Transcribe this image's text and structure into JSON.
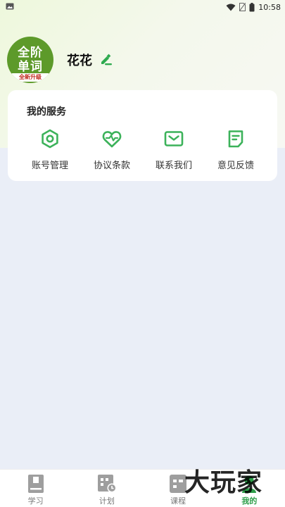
{
  "status_bar": {
    "time": "10:58"
  },
  "profile": {
    "logo_line1": "全阶",
    "logo_line2": "单词",
    "logo_tag": "全新升级",
    "username": "花花"
  },
  "services": {
    "title": "我的服务",
    "items": [
      {
        "label": "账号管理",
        "icon": "hexagon-gear-icon"
      },
      {
        "label": "协议条款",
        "icon": "heart-wave-icon"
      },
      {
        "label": "联系我们",
        "icon": "mail-icon"
      },
      {
        "label": "意见反馈",
        "icon": "note-icon"
      }
    ]
  },
  "bottom_nav": {
    "items": [
      {
        "label": "学习",
        "icon": "book-icon",
        "active": false
      },
      {
        "label": "计划",
        "icon": "calendar-clock-icon",
        "active": false
      },
      {
        "label": "课程",
        "icon": "course-grid-icon",
        "active": false
      },
      {
        "label": "我的",
        "icon": "person-icon",
        "active": true
      }
    ]
  },
  "watermark": "大玩家",
  "colors": {
    "accent": "#2e9e4a",
    "icon_green": "#3cb25a",
    "background": "#eaeef7",
    "logo_green": "#5d9a2a"
  }
}
